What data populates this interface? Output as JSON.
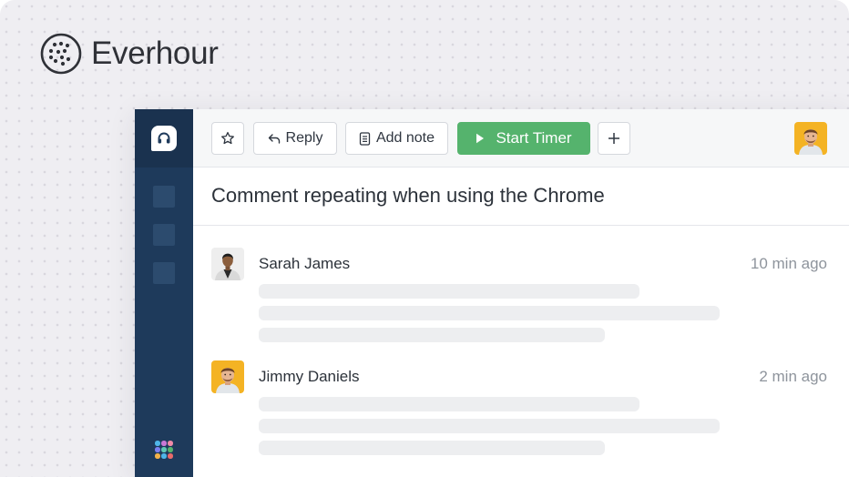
{
  "brand": {
    "name": "Everhour"
  },
  "toolbar": {
    "star_icon": "star-icon",
    "reply_label": "Reply",
    "add_note_label": "Add note",
    "start_timer_label": "Start Timer",
    "add_icon": "plus-icon"
  },
  "ticket": {
    "title": "Comment repeating when using the Chrome"
  },
  "comments": [
    {
      "author": "Sarah James",
      "time": "10 min ago"
    },
    {
      "author": "Jimmy Daniels",
      "time": "2 min ago"
    }
  ],
  "colors": {
    "sidebar": "#1e3a5b",
    "accent_green": "#55b36d",
    "page_background": "#efeef2"
  }
}
